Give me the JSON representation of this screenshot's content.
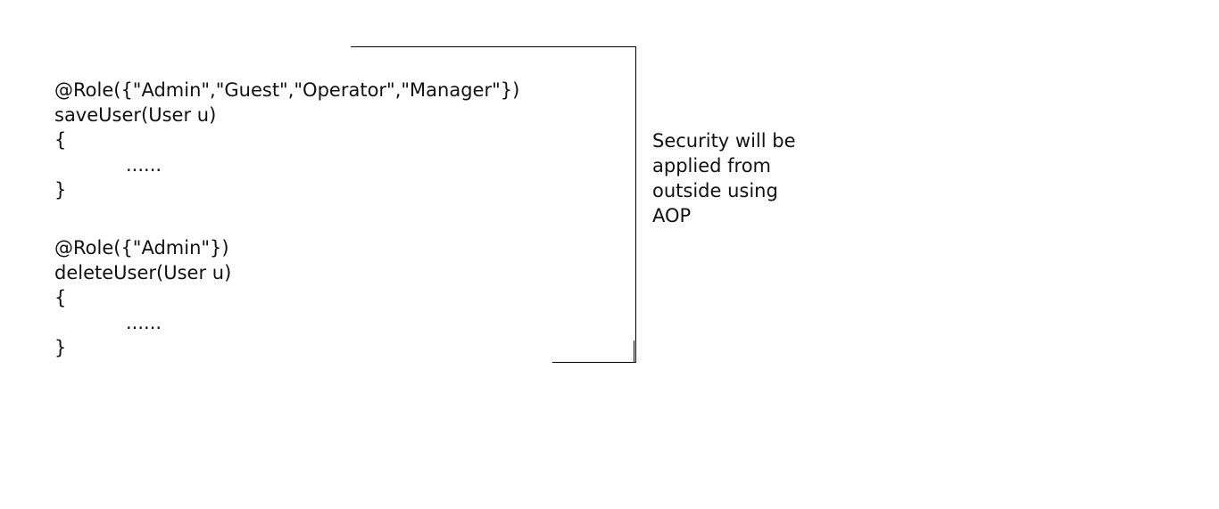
{
  "method1": {
    "annotation": "@Role({\"Admin\",\"Guest\",\"Operator\",\"Manager\"})",
    "signature": "saveUser(User u)",
    "open_brace": "{",
    "body": "......",
    "close_brace": "}"
  },
  "method2": {
    "annotation": "@Role({\"Admin\"})",
    "signature": "deleteUser(User u)",
    "open_brace": "{",
    "body": "......",
    "close_brace": "}"
  },
  "note": {
    "lines": [
      "Security will be",
      "applied from",
      "outside using",
      "AOP"
    ]
  }
}
